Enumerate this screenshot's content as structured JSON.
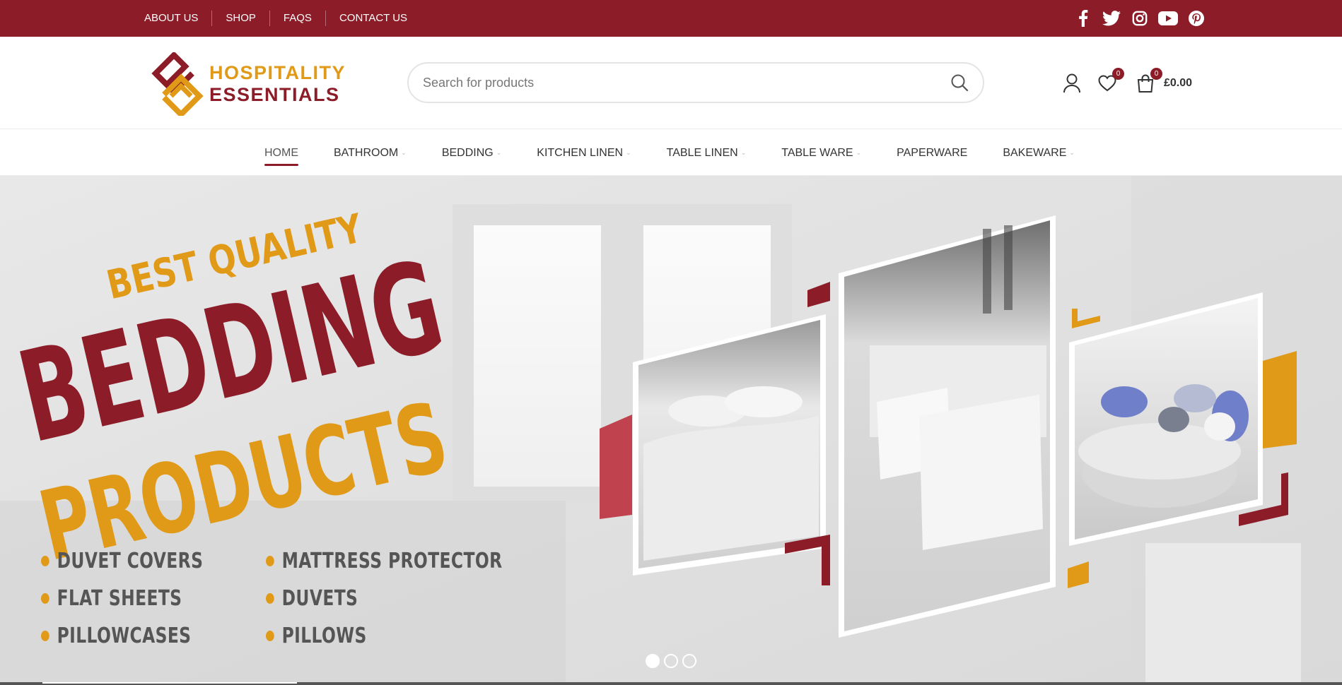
{
  "topbar": {
    "links": [
      "ABOUT US",
      "SHOP",
      "FAQS",
      "CONTACT US"
    ],
    "social_icons": [
      "facebook-icon",
      "twitter-icon",
      "instagram-icon",
      "youtube-icon",
      "pinterest-icon"
    ],
    "color": "#8b1c28"
  },
  "header": {
    "logo_line1": "HOSPITALITY",
    "logo_line2": "ESSENTIALS",
    "search_placeholder": "Search for products",
    "wishlist_count": "0",
    "cart_count": "0",
    "cart_total": "£0.00"
  },
  "nav": {
    "items": [
      {
        "label": "HOME",
        "active": true,
        "dropdown": false
      },
      {
        "label": "BATHROOM",
        "active": false,
        "dropdown": true
      },
      {
        "label": "BEDDING",
        "active": false,
        "dropdown": true
      },
      {
        "label": "KITCHEN LINEN",
        "active": false,
        "dropdown": true
      },
      {
        "label": "TABLE LINEN",
        "active": false,
        "dropdown": true
      },
      {
        "label": "TABLE WARE",
        "active": false,
        "dropdown": true
      },
      {
        "label": "PAPERWARE",
        "active": false,
        "dropdown": false
      },
      {
        "label": "BAKEWARE",
        "active": false,
        "dropdown": true
      }
    ]
  },
  "hero": {
    "tagline": "BEST QUALITY",
    "headline1": "BEDDING",
    "headline2": "PRODUCTS",
    "list": [
      "DUVET COVERS",
      "MATTRESS PROTECTOR",
      "FLAT SHEETS",
      "DUVETS",
      "PILLOWCASES",
      "PILLOWS"
    ],
    "slides": 3,
    "active_slide": 1
  },
  "colors": {
    "brand_red": "#8b1c28",
    "brand_gold": "#e09a17"
  }
}
